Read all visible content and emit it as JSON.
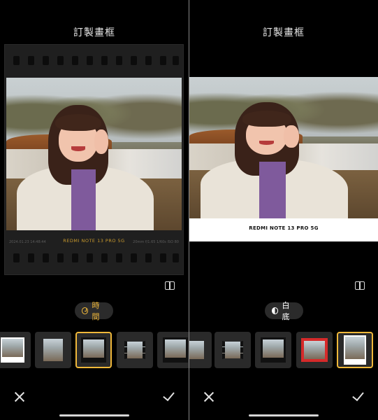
{
  "left_panel": {
    "title": "訂製畫框",
    "film_info": {
      "date": "2024.01.23  14:48:44",
      "model": "REDMI NOTE 13 PRO 5G",
      "exif": "20mm  f/1.65  1/60s  ISO 80"
    },
    "mode_pill": {
      "icon": "clock-icon",
      "label": "時間"
    },
    "thumbnails": [
      "white-border-logo",
      "white-tall",
      "film-frame",
      "film-strip",
      "dark-frame"
    ],
    "selected_thumbnail": 2
  },
  "right_panel": {
    "title": "訂製畫框",
    "caption": "REDMI NOTE 13 PRO 5G",
    "mode_pill": {
      "icon": "contrast-icon",
      "label": "白底"
    },
    "thumbnails": [
      "partial",
      "film-strip",
      "dark-frame",
      "red-frame",
      "white-frame"
    ],
    "selected_thumbnail": 4
  },
  "colors": {
    "accent": "#f0b83a",
    "background": "#000000"
  }
}
